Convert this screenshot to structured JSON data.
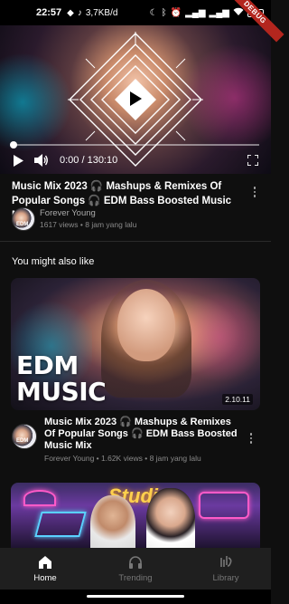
{
  "status_bar": {
    "time": "22:57",
    "speed": "3,7KB/d",
    "battery": "",
    "debug_label": "DEBUG"
  },
  "player": {
    "time_text": "0:00 / 130:10",
    "progress": 0.0,
    "icons": {
      "play": "play-icon",
      "volume": "volume-icon",
      "fullscreen": "fullscreen-icon"
    }
  },
  "video": {
    "title": "Music Mix 2023 🎧 Mashups & Remixes Of Popular Songs 🎧 EDM Bass Boosted Music Mix",
    "channel": "Forever Young",
    "views": "1617 views",
    "age": "8 jam yang lalu"
  },
  "section_title": "You might also like",
  "recommended": [
    {
      "thumbnail_text": [
        "EDM",
        "MUSIC"
      ],
      "duration": "2.10.11",
      "title": "Music Mix 2023 🎧 Mashups & Remixes Of Popular Songs 🎧 EDM Bass Boosted Music Mix",
      "channel": "Forever Young",
      "views": "1.62K views",
      "age": "8 jam yang lalu"
    },
    {
      "thumbnail_text": "Studio"
    }
  ],
  "bottom_nav": {
    "items": [
      {
        "label": "Home",
        "icon": "home-icon",
        "active": true
      },
      {
        "label": "Trending",
        "icon": "headphones-icon",
        "active": false
      },
      {
        "label": "Library",
        "icon": "library-icon",
        "active": false
      }
    ]
  },
  "colors": {
    "background": "#0f0f0f",
    "nav_background": "#1f1f1f",
    "secondary_text": "#8a8a8a",
    "debug_ribbon": "#b3261e"
  }
}
